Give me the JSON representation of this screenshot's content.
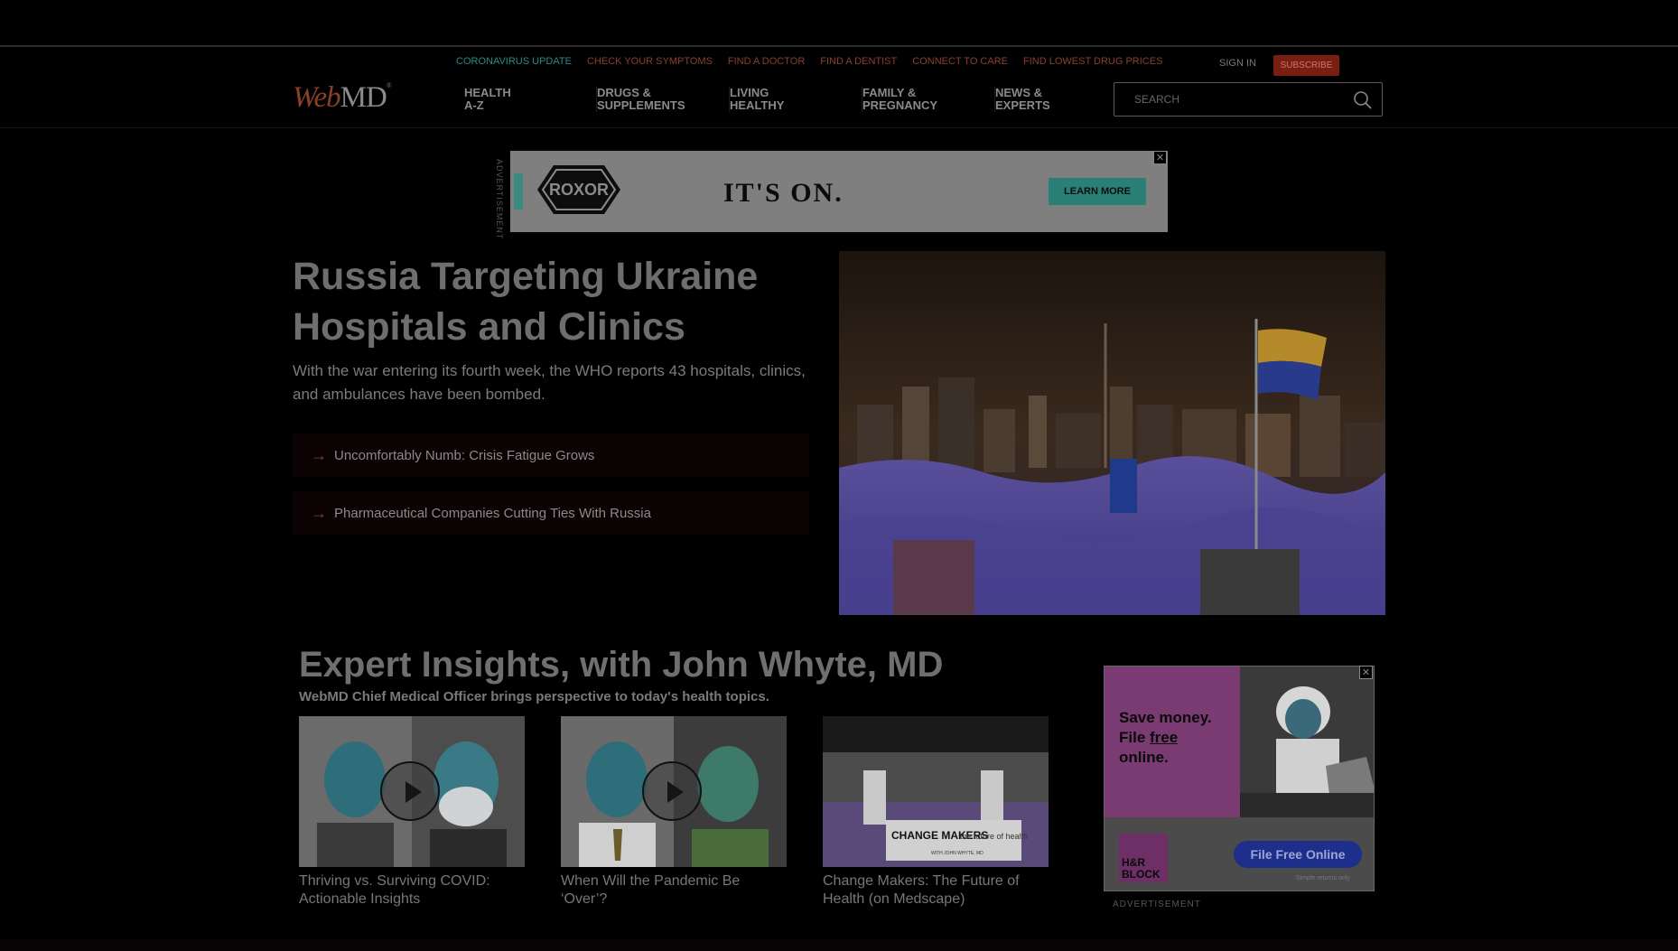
{
  "util_links": [
    "CORONAVIRUS UPDATE",
    "CHECK YOUR SYMPTOMS",
    "FIND A DOCTOR",
    "FIND A DENTIST",
    "CONNECT TO CARE",
    "FIND LOWEST DRUG PRICES"
  ],
  "account": {
    "sign_in": "SIGN IN",
    "subscribe": "SUBSCRIBE"
  },
  "logo": {
    "web": "Web",
    "md": "MD",
    "reg": "®"
  },
  "nav": [
    {
      "line1": "HEALTH",
      "line2": "A-Z"
    },
    {
      "line1": "DRUGS &",
      "line2": "SUPPLEMENTS"
    },
    {
      "line1": "LIVING",
      "line2": "HEALTHY"
    },
    {
      "line1": "FAMILY &",
      "line2": "PREGNANCY"
    },
    {
      "line1": "NEWS &",
      "line2": "EXPERTS"
    }
  ],
  "search": {
    "placeholder": "SEARCH"
  },
  "top_ad": {
    "label": "ADVERTISEMENT",
    "brand": "ROXOR",
    "headline": "IT'S ON.",
    "cta": "LEARN MORE",
    "close": "✕"
  },
  "hero": {
    "title": "Russia Targeting Ukraine Hospitals and Clinics",
    "subtitle": "With the war entering its fourth week, the WHO reports 43 hospitals, clinics, and ambulances have been bombed.",
    "links": [
      "Uncomfortably Numb: Crisis Fatigue Grows",
      "Pharmaceutical Companies Cutting Ties With Russia"
    ]
  },
  "expert": {
    "title": "Expert Insights, with John Whyte, MD",
    "subtitle": "WebMD Chief Medical Officer brings perspective to today's health topics.",
    "cards": [
      {
        "caption": "Thriving vs. Surviving COVID: Actionable Insights"
      },
      {
        "caption": "When Will the Pandemic Be ‘Over’?"
      },
      {
        "caption": "Change Makers: The Future of Health (on Medscape)"
      }
    ],
    "card3_overlay": {
      "left": "CHANGE MAKERS",
      "right": "the future of health",
      "by": "WITH JOHN WHYTE, MD"
    }
  },
  "side_ad": {
    "line1": "Save money.",
    "line2_pre": "File ",
    "line2_u": "free",
    "line3": "online.",
    "logo": "H&R BLOCK",
    "cta": "File Free Online",
    "fine": "Simple returns only",
    "label": "ADVERTISEMENT",
    "close": "✕"
  }
}
